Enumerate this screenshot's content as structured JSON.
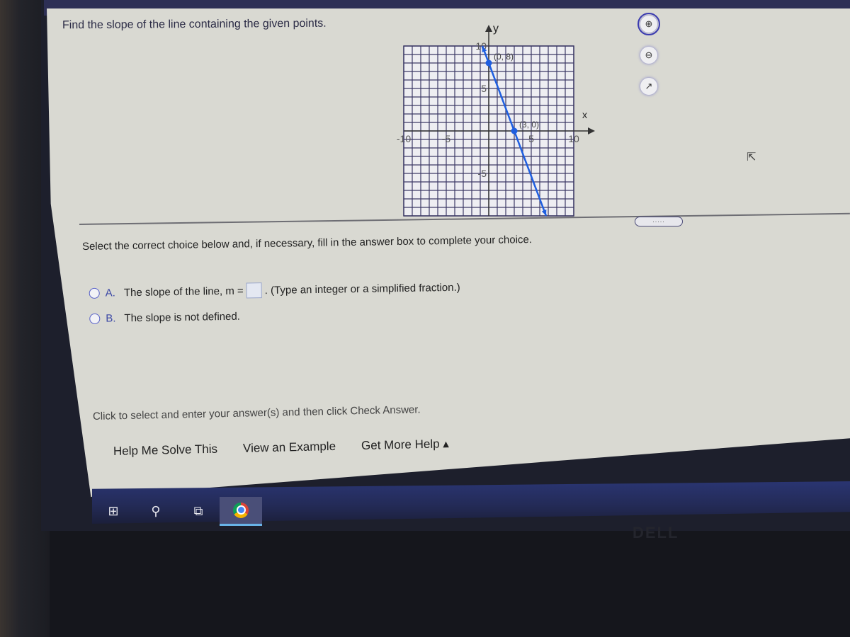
{
  "question": {
    "title": "Find the slope of the line containing the given points."
  },
  "tools": [
    {
      "icon": "zoom-in-icon",
      "glyph": "⊕"
    },
    {
      "icon": "zoom-out-icon",
      "glyph": "⊖"
    },
    {
      "icon": "popout-icon",
      "glyph": "↗"
    }
  ],
  "graph": {
    "x_label": "x",
    "y_label": "y",
    "x_range": [
      -10,
      10
    ],
    "y_range": [
      -10,
      10
    ],
    "x_ticks": [
      "-10",
      "-5",
      "5",
      "10"
    ],
    "y_ticks": [
      "10",
      "5",
      "-5"
    ],
    "points": [
      {
        "x": 0,
        "y": 8,
        "label": "(0, 8)"
      },
      {
        "x": 3,
        "y": 0,
        "label": "(3, 0)"
      }
    ],
    "line_color": "#1f5fe0"
  },
  "expand_label": ".....",
  "instructions": "Select the correct choice below and, if necessary, fill in the answer box to complete your choice.",
  "choices": [
    {
      "letter": "A.",
      "text_before": "The slope of the line, m =",
      "text_after": ". (Type an integer or a simplified fraction.)",
      "answer_value": ""
    },
    {
      "letter": "B.",
      "text": "The slope is not defined."
    }
  ],
  "hint": "Click to select and enter your answer(s) and then click Check Answer.",
  "help": {
    "solve": "Help Me Solve This",
    "example": "View an Example",
    "more": "Get More Help ▴"
  },
  "taskbar": {
    "start": "⊞",
    "search": "⚲",
    "taskview": "⧉"
  },
  "brand": "DELL"
}
